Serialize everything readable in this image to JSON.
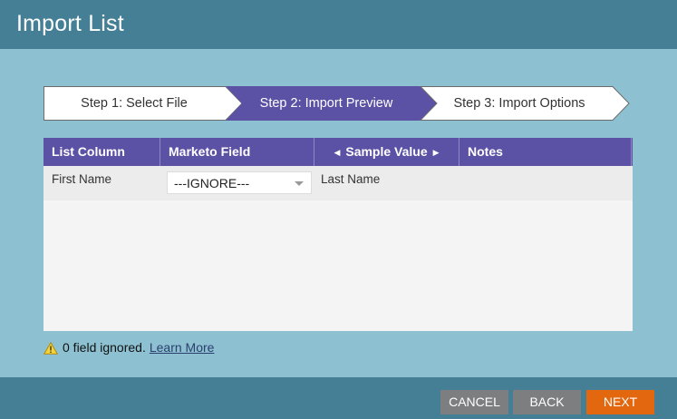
{
  "header": {
    "title": "Import List"
  },
  "steps": [
    {
      "label": "Step 1: Select File",
      "state": "done"
    },
    {
      "label": "Step 2: Import Preview",
      "state": "active"
    },
    {
      "label": "Step 3: Import Options",
      "state": "pending"
    }
  ],
  "table": {
    "columns": [
      "List Column",
      "Marketo Field",
      "Sample Value",
      "Notes"
    ],
    "rows": [
      {
        "list_column": "First Name",
        "marketo_field": "---IGNORE---",
        "sample_value": "Last Name",
        "notes": ""
      }
    ]
  },
  "warning": {
    "text": "0 field ignored.",
    "link": "Learn More"
  },
  "footer": {
    "cancel": "CANCEL",
    "back": "BACK",
    "next": "NEXT"
  },
  "colors": {
    "header_bg": "#457f96",
    "page_bg": "#8dc1d2",
    "accent_purple": "#5b52a6",
    "next_orange": "#e2670e",
    "button_gray": "#7c7e80"
  },
  "icons": {
    "warning": "warning-triangle-icon",
    "select_caret": "chevron-down-icon"
  }
}
